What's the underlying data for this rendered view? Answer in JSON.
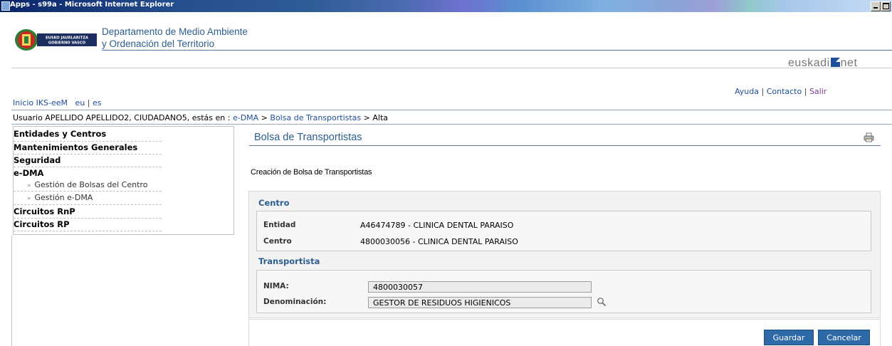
{
  "window": {
    "title": "Apps - s99a - Microsoft Internet Explorer"
  },
  "header": {
    "logo_text_1": "EUSKO JAURLARITZA",
    "logo_text_2": "GOBIERNO VASCO",
    "department_line1": "Departamento de Medio Ambiente",
    "department_line2": "y Ordenación del Territorio",
    "brand": {
      "part1": "euskadi",
      "part2": "net"
    },
    "nav_left": {
      "home": "Inicio IKS-eeM",
      "lang_eu": "eu",
      "sep": "|",
      "lang_es": "es"
    },
    "nav_right": {
      "help": "Ayuda",
      "contact": "Contacto",
      "exit": "Salir",
      "sep": "|"
    }
  },
  "breadcrumb": {
    "prefix": "Usuario APELLIDO APELLIDO2, CIUDADANO5, estás en : ",
    "crumbs": [
      "e-DMA",
      "Bolsa de Transportistas",
      "Alta"
    ],
    "sep": " > "
  },
  "sidebar": {
    "items": [
      {
        "label": "Entidades y Centros"
      },
      {
        "label": "Mantenimientos Generales"
      },
      {
        "label": "Seguridad"
      },
      {
        "label": "e-DMA",
        "subitems": [
          "Gestión de Bolsas del Centro",
          "Gestión e-DMA"
        ]
      },
      {
        "label": "Circuitos RnP"
      },
      {
        "label": "Circuitos RP"
      }
    ],
    "sub_marker": "»"
  },
  "main": {
    "title": "Bolsa de Transportistas",
    "subtitle": "Creación de Bolsa de Transportistas",
    "centro_section": {
      "title": "Centro",
      "entidad_label": "Entidad",
      "entidad_value": "A46474789 - CLINICA DENTAL PARAISO",
      "centro_label": "Centro",
      "centro_value": "4800030056 - CLINICA DENTAL PARAISO"
    },
    "transportista_section": {
      "title": "Transportista",
      "nima_label": "NIMA:",
      "nima_value": "4800030057",
      "denominacion_label": "Denominación:",
      "denominacion_value": "GESTOR DE RESIDUOS HIGIENICOS"
    },
    "buttons": {
      "save": "Guardar",
      "cancel": "Cancelar"
    }
  },
  "colors": {
    "accent": "#2c5d90",
    "button": "#2f6aa8",
    "link": "#1d4f9a"
  },
  "icons": [
    "printer-icon",
    "magnifier-icon",
    "window-icon"
  ]
}
